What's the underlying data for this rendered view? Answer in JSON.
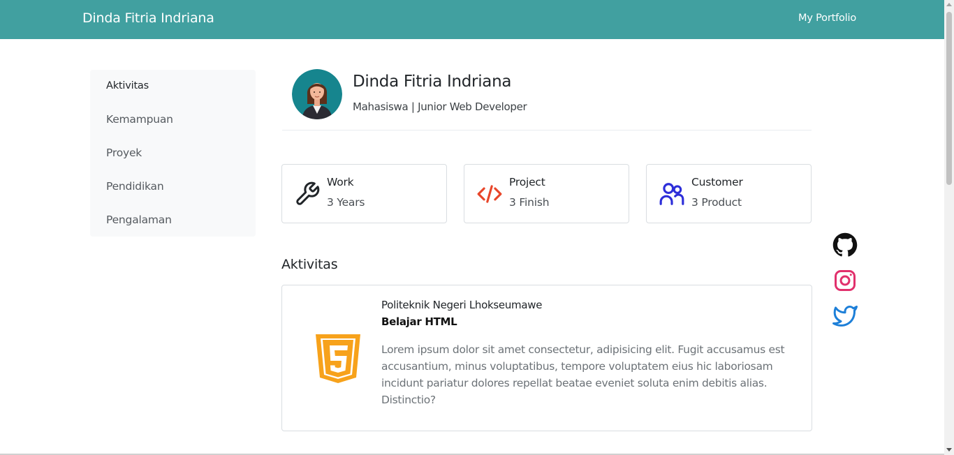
{
  "navbar": {
    "brand": "Dinda Fitria Indriana",
    "link": "My Portfolio"
  },
  "sidebar": {
    "items": [
      {
        "label": "Aktivitas",
        "active": true
      },
      {
        "label": "Kemampuan",
        "active": false
      },
      {
        "label": "Proyek",
        "active": false
      },
      {
        "label": "Pendidikan",
        "active": false
      },
      {
        "label": "Pengalaman",
        "active": false
      }
    ]
  },
  "profile": {
    "name": "Dinda Fitria Indriana",
    "role": "Mahasiswa | Junior Web Developer",
    "avatar_icon": "female-avatar-icon"
  },
  "stats": [
    {
      "title": "Work",
      "value": "3 Years",
      "icon": "wrench-icon",
      "color": "#212529"
    },
    {
      "title": "Project",
      "value": "3 Finish",
      "icon": "code-icon",
      "color": "#e8462a"
    },
    {
      "title": "Customer",
      "value": "3 Product",
      "icon": "users-icon",
      "color": "#2d2ed9"
    }
  ],
  "section": {
    "title": "Aktivitas"
  },
  "activity": {
    "org": "Politeknik Negeri Lhokseumawe",
    "title": "Belajar HTML",
    "description": "Lorem ipsum dolor sit amet consectetur, adipisicing elit. Fugit accusamus est accusantium, minus voluptatibus, tempore voluptatem eius hic laboriosam incidunt pariatur dolores repellat beatae eveniet soluta enim debitis alias. Distinctio?",
    "icon": "html5-icon",
    "icon_color": "#f7a21b"
  },
  "social": [
    {
      "icon": "github-icon",
      "color": "#111111"
    },
    {
      "icon": "instagram-icon",
      "color": "#e1306c"
    },
    {
      "icon": "twitter-icon",
      "color": "#1d7fd8"
    }
  ],
  "colors": {
    "navbar_bg": "#41a0a0",
    "sidebar_bg": "#f8f9fa"
  }
}
